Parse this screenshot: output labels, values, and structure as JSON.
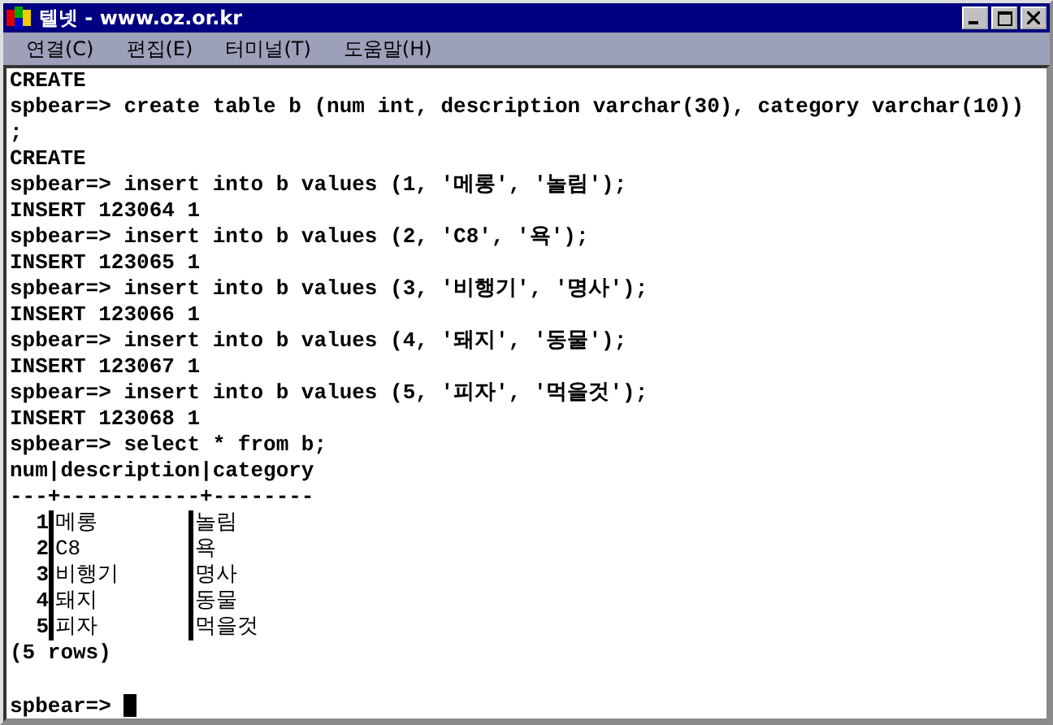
{
  "window": {
    "title": "텔넷 - www.oz.or.kr"
  },
  "menu": [
    {
      "label": "연결(C)"
    },
    {
      "label": "편집(E)"
    },
    {
      "label": "터미널(T)"
    },
    {
      "label": "도움말(H)"
    }
  ],
  "terminal": {
    "lines": [
      {
        "kind": "text",
        "text": "CREATE"
      },
      {
        "kind": "text",
        "text": "spbear=> create table b (num int, description varchar(30), category varchar(10))"
      },
      {
        "kind": "text",
        "text": ";"
      },
      {
        "kind": "text",
        "text": "CREATE"
      },
      {
        "kind": "text",
        "text": "spbear=> insert into b values (1, '메롱', '놀림');"
      },
      {
        "kind": "text",
        "text": "INSERT 123064 1"
      },
      {
        "kind": "text",
        "text": "spbear=> insert into b values (2, 'C8', '욕');"
      },
      {
        "kind": "text",
        "text": "INSERT 123065 1"
      },
      {
        "kind": "text",
        "text": "spbear=> insert into b values (3, '비행기', '명사');"
      },
      {
        "kind": "text",
        "text": "INSERT 123066 1"
      },
      {
        "kind": "text",
        "text": "spbear=> insert into b values (4, '돼지', '동물');"
      },
      {
        "kind": "text",
        "text": "INSERT 123067 1"
      },
      {
        "kind": "text",
        "text": "spbear=> insert into b values (5, '피자', '먹을것');"
      },
      {
        "kind": "text",
        "text": "INSERT 123068 1"
      },
      {
        "kind": "text",
        "text": "spbear=> select * from b;"
      },
      {
        "kind": "text",
        "text": "num|description|category"
      },
      {
        "kind": "text",
        "text": "---+-----------+--------"
      },
      {
        "kind": "row",
        "cells": [
          "1",
          "메롱",
          "놀림"
        ]
      },
      {
        "kind": "row",
        "cells": [
          "2",
          "C8",
          "욕"
        ]
      },
      {
        "kind": "row",
        "cells": [
          "3",
          "비행기",
          "명사"
        ]
      },
      {
        "kind": "row",
        "cells": [
          "4",
          "돼지",
          "동물"
        ]
      },
      {
        "kind": "row",
        "cells": [
          "5",
          "피자",
          "먹을것"
        ]
      },
      {
        "kind": "text",
        "text": "(5 rows)"
      },
      {
        "kind": "blank"
      },
      {
        "kind": "prompt",
        "text": "spbear=>"
      }
    ]
  }
}
